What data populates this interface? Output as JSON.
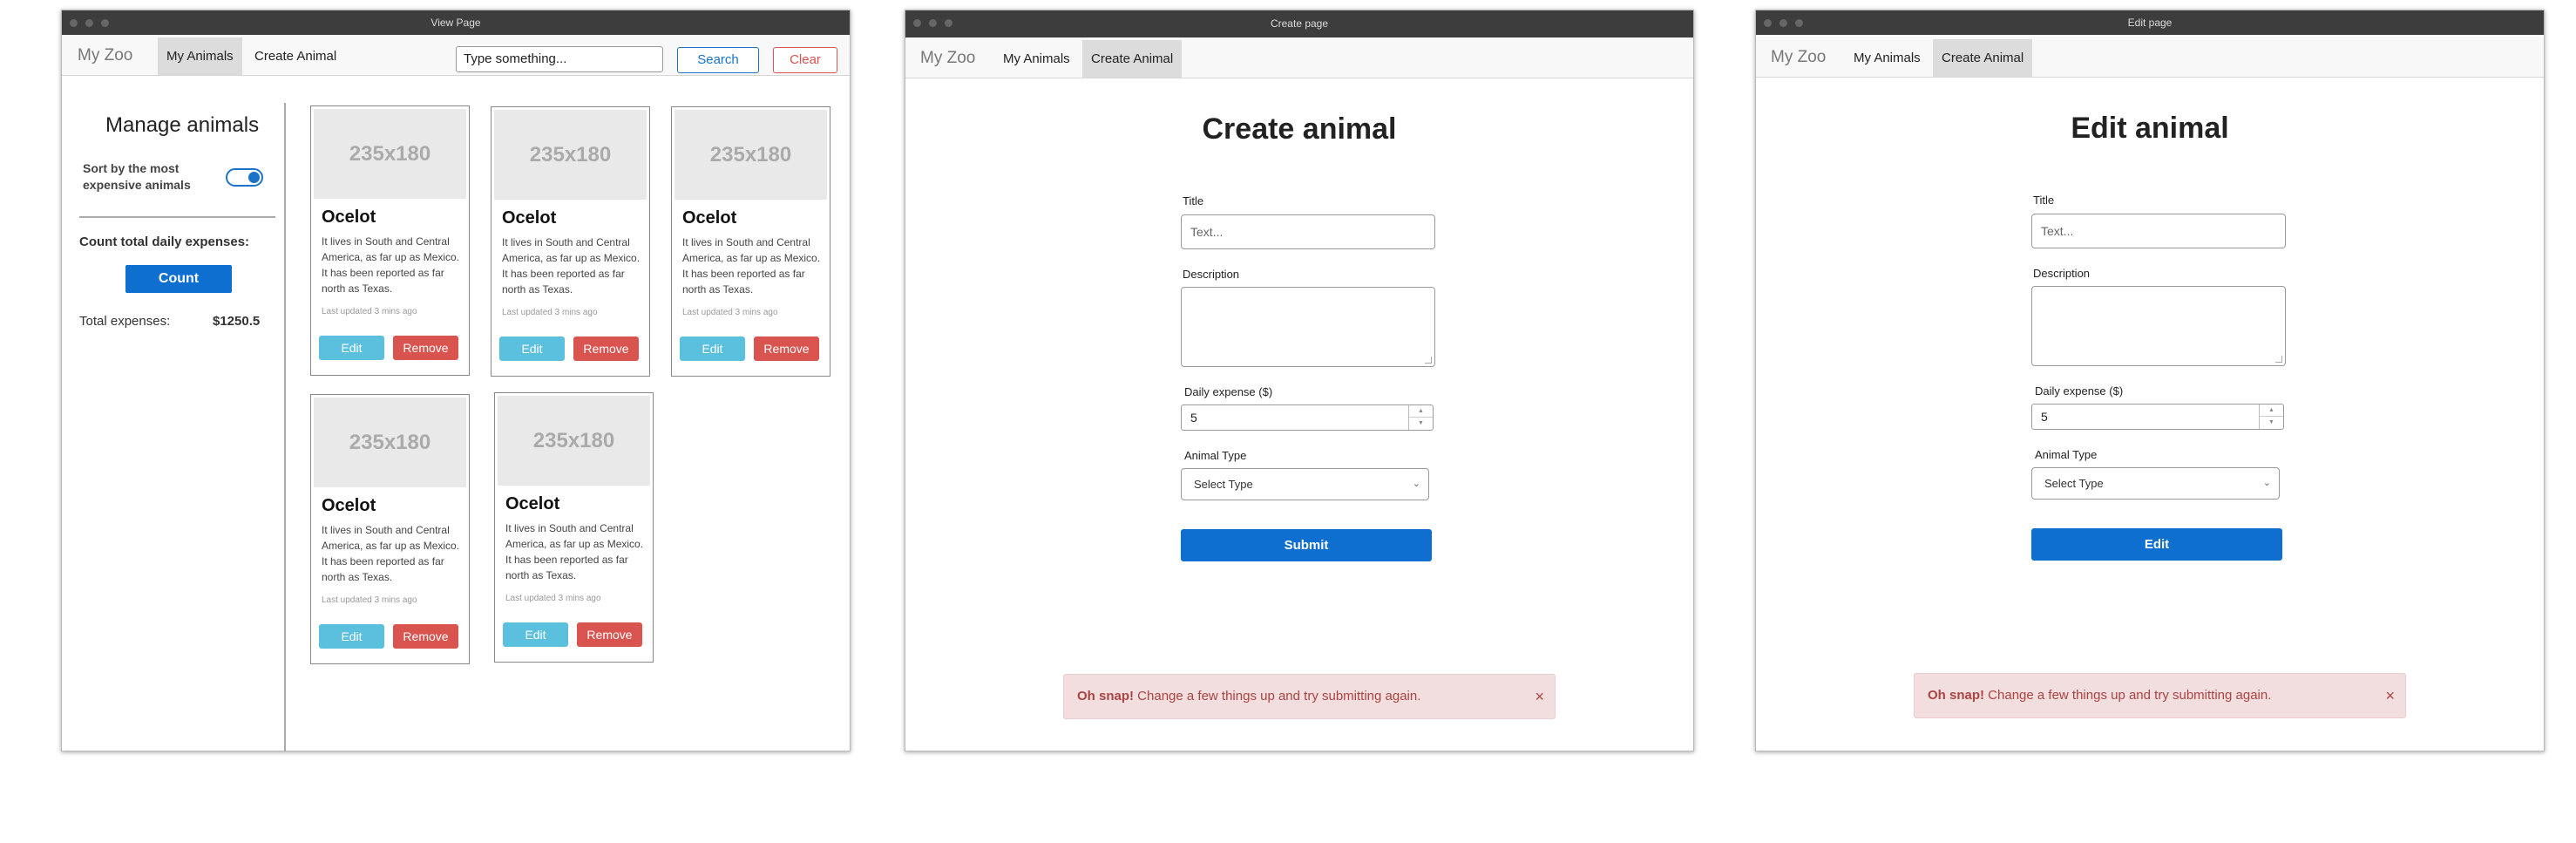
{
  "view_window": {
    "title": "View Page",
    "nav": {
      "brand": "My Zoo",
      "my_animals": "My Animals",
      "create_animal": "Create Animal"
    },
    "search": {
      "value": "Type something...",
      "search_label": "Search",
      "clear_label": "Clear"
    },
    "sidebar": {
      "title": "Manage animals",
      "sort_label": "Sort by the most expensive animals",
      "sort_enabled": true,
      "count_label": "Count total daily expenses:",
      "count_button": "Count",
      "total_label": "Total expenses:",
      "total_value": "$1250.5"
    },
    "cards": [
      {
        "image": "235x180",
        "title": "Ocelot",
        "description": "It lives in South and Central America, as far up as Mexico. It has been reported as far north as Texas.",
        "updated": "Last updated 3 mins ago",
        "edit": "Edit",
        "remove": "Remove"
      },
      {
        "image": "235x180",
        "title": "Ocelot",
        "description": "It lives in South and Central America, as far up as Mexico. It has been reported as far north as Texas.",
        "updated": "Last updated 3 mins ago",
        "edit": "Edit",
        "remove": "Remove"
      },
      {
        "image": "235x180",
        "title": "Ocelot",
        "description": "It lives in South and Central America, as far up as Mexico. It has been reported as far north as Texas.",
        "updated": "Last updated 3 mins ago",
        "edit": "Edit",
        "remove": "Remove"
      },
      {
        "image": "235x180",
        "title": "Ocelot",
        "description": "It lives in South and Central America, as far up as Mexico. It has been reported as far north as Texas.",
        "updated": "Last updated 3 mins ago",
        "edit": "Edit",
        "remove": "Remove"
      },
      {
        "image": "235x180",
        "title": "Ocelot",
        "description": "It lives in South and Central America, as far up as Mexico. It has been reported as far north as Texas.",
        "updated": "Last updated 3 mins ago",
        "edit": "Edit",
        "remove": "Remove"
      }
    ]
  },
  "create_window": {
    "title": "Create page",
    "nav": {
      "brand": "My Zoo",
      "my_animals": "My Animals",
      "create_animal": "Create Animal"
    },
    "heading": "Create animal",
    "title_label": "Title",
    "title_placeholder": "Text...",
    "description_label": "Description",
    "expense_label": "Daily expense ($)",
    "expense_value": "5",
    "type_label": "Animal Type",
    "type_value": "Select Type",
    "submit_label": "Submit",
    "alert": {
      "strong": "Oh snap!",
      "text": " Change a few things up and try submitting again.",
      "close": "×"
    }
  },
  "edit_window": {
    "title": "Edit page",
    "nav": {
      "brand": "My Zoo",
      "my_animals": "My Animals",
      "create_animal": "Create Animal"
    },
    "heading": "Edit animal",
    "title_label": "Title",
    "title_placeholder": "Text...",
    "description_label": "Description",
    "expense_label": "Daily expense ($)",
    "expense_value": "5",
    "type_label": "Animal Type",
    "type_value": "Select Type",
    "submit_label": "Edit",
    "alert": {
      "strong": "Oh snap!",
      "text": " Change a few things up and try submitting again.",
      "close": "×"
    }
  },
  "colors": {
    "primary": "#0f6fd1",
    "info": "#5bc0de",
    "danger": "#d9534f",
    "alert_bg": "#f2dede",
    "titlebar": "#3d3d3d"
  }
}
